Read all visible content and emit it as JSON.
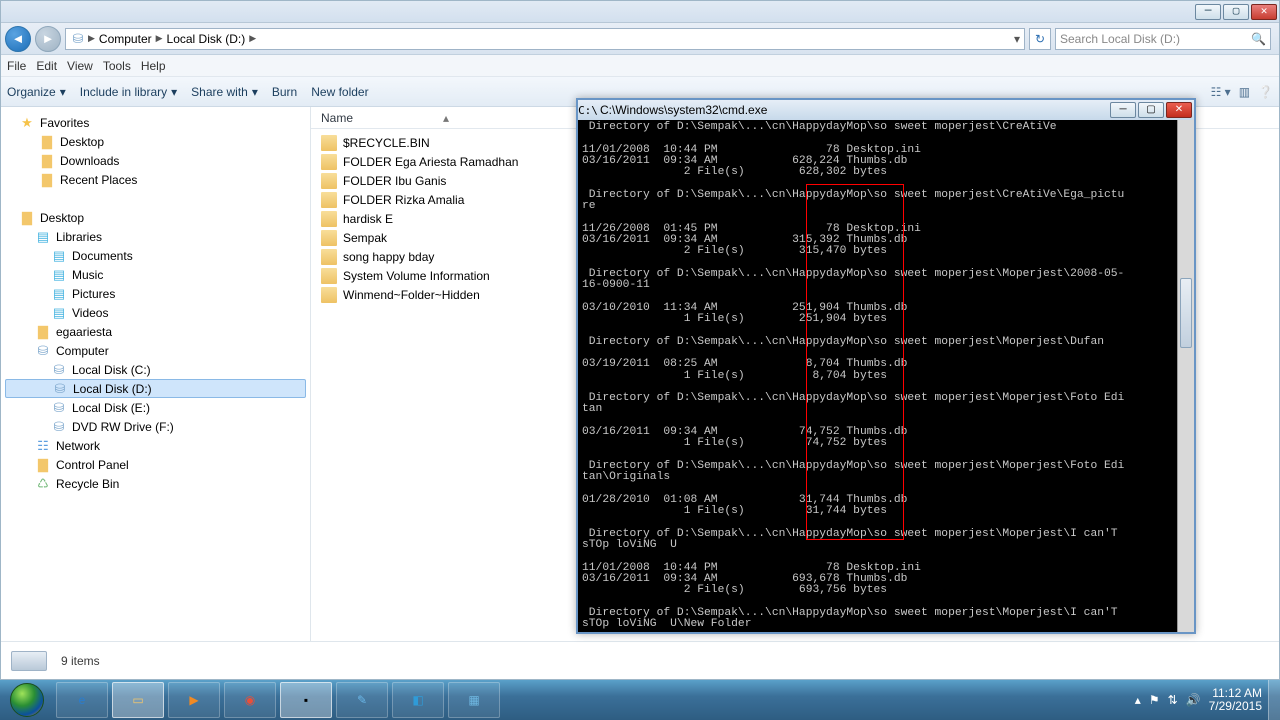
{
  "breadcrumb": [
    "Computer",
    "Local Disk (D:)"
  ],
  "search_placeholder": "Search Local Disk (D:)",
  "menubar": [
    "File",
    "Edit",
    "View",
    "Tools",
    "Help"
  ],
  "toolbar": [
    "Organize",
    "Include in library",
    "Share with",
    "Burn",
    "New folder"
  ],
  "tree": [
    {
      "lbl": "Favorites",
      "ind": 14,
      "ico": "star"
    },
    {
      "lbl": "Desktop",
      "ind": 34,
      "ico": "folder"
    },
    {
      "lbl": "Downloads",
      "ind": 34,
      "ico": "folder"
    },
    {
      "lbl": "Recent Places",
      "ind": 34,
      "ico": "folder"
    },
    {
      "lbl": "",
      "ind": 0,
      "ico": ""
    },
    {
      "lbl": "Desktop",
      "ind": 14,
      "ico": "folder"
    },
    {
      "lbl": "Libraries",
      "ind": 30,
      "ico": "lib"
    },
    {
      "lbl": "Documents",
      "ind": 46,
      "ico": "lib"
    },
    {
      "lbl": "Music",
      "ind": 46,
      "ico": "lib"
    },
    {
      "lbl": "Pictures",
      "ind": 46,
      "ico": "lib"
    },
    {
      "lbl": "Videos",
      "ind": 46,
      "ico": "lib"
    },
    {
      "lbl": "egaariesta",
      "ind": 30,
      "ico": "folder"
    },
    {
      "lbl": "Computer",
      "ind": 30,
      "ico": "drive"
    },
    {
      "lbl": "Local Disk (C:)",
      "ind": 46,
      "ico": "drive"
    },
    {
      "lbl": "Local Disk (D:)",
      "ind": 46,
      "ico": "drive",
      "sel": true
    },
    {
      "lbl": "Local Disk (E:)",
      "ind": 46,
      "ico": "drive"
    },
    {
      "lbl": "DVD RW Drive (F:)",
      "ind": 46,
      "ico": "drive"
    },
    {
      "lbl": "Network",
      "ind": 30,
      "ico": "net"
    },
    {
      "lbl": "Control Panel",
      "ind": 30,
      "ico": "folder"
    },
    {
      "lbl": "Recycle Bin",
      "ind": 30,
      "ico": "recy"
    }
  ],
  "col_name": "Name",
  "files": [
    "$RECYCLE.BIN",
    "FOLDER Ega Ariesta Ramadhan",
    "FOLDER Ibu Ganis",
    "FOLDER Rizka Amalia",
    "hardisk E",
    "Sempak",
    "song happy bday",
    "System Volume Information",
    "Winmend~Folder~Hidden"
  ],
  "status": "9 items",
  "cmd_title": "C:\\Windows\\system32\\cmd.exe",
  "cmd_text": " Directory of D:\\Sempak\\...\\cn\\HappydayMop\\so sweet moperjest\\CreAtiVe\n\n11/01/2008  10:44 PM                78 Desktop.ini\n03/16/2011  09:34 AM           628,224 Thumbs.db\n               2 File(s)        628,302 bytes\n\n Directory of D:\\Sempak\\...\\cn\\HappydayMop\\so sweet moperjest\\CreAtiVe\\Ega_pictu\nre\n\n11/26/2008  01:45 PM                78 Desktop.ini\n03/16/2011  09:34 AM           315,392 Thumbs.db\n               2 File(s)        315,470 bytes\n\n Directory of D:\\Sempak\\...\\cn\\HappydayMop\\so sweet moperjest\\Moperjest\\2008-05-\n16-0900-11\n\n03/10/2010  11:34 AM           251,904 Thumbs.db\n               1 File(s)        251,904 bytes\n\n Directory of D:\\Sempak\\...\\cn\\HappydayMop\\so sweet moperjest\\Moperjest\\Dufan\n\n03/19/2011  08:25 AM             8,704 Thumbs.db\n               1 File(s)          8,704 bytes\n\n Directory of D:\\Sempak\\...\\cn\\HappydayMop\\so sweet moperjest\\Moperjest\\Foto Edi\ntan\n\n03/16/2011  09:34 AM            74,752 Thumbs.db\n               1 File(s)         74,752 bytes\n\n Directory of D:\\Sempak\\...\\cn\\HappydayMop\\so sweet moperjest\\Moperjest\\Foto Edi\ntan\\Originals\n\n01/28/2010  01:08 AM            31,744 Thumbs.db\n               1 File(s)         31,744 bytes\n\n Directory of D:\\Sempak\\...\\cn\\HappydayMop\\so sweet moperjest\\Moperjest\\I can'T \nsTOp loViNG  U\n\n11/01/2008  10:44 PM                78 Desktop.ini\n03/16/2011  09:34 AM           693,678 Thumbs.db\n               2 File(s)        693,756 bytes\n\n Directory of D:\\Sempak\\...\\cn\\HappydayMop\\so sweet moperjest\\Moperjest\\I can'T \nsTOp loViNG  U\\New Folder",
  "tasks": [
    {
      "name": "ie",
      "glyph": "e",
      "color": "#2a7dd1"
    },
    {
      "name": "explorer",
      "glyph": "▭",
      "color": "#f3c76b",
      "active": true
    },
    {
      "name": "wmp",
      "glyph": "▶",
      "color": "#f08a24"
    },
    {
      "name": "chrome",
      "glyph": "◉",
      "color": "#e94f3a"
    },
    {
      "name": "cmd",
      "glyph": "▪",
      "color": "#000",
      "active": true
    },
    {
      "name": "paint",
      "glyph": "✎",
      "color": "#6ab7e8"
    },
    {
      "name": "app1",
      "glyph": "◧",
      "color": "#2f9bd8"
    },
    {
      "name": "app2",
      "glyph": "▦",
      "color": "#6fb8e2"
    }
  ],
  "clock": {
    "time": "11:12 AM",
    "date": "7/29/2015"
  }
}
